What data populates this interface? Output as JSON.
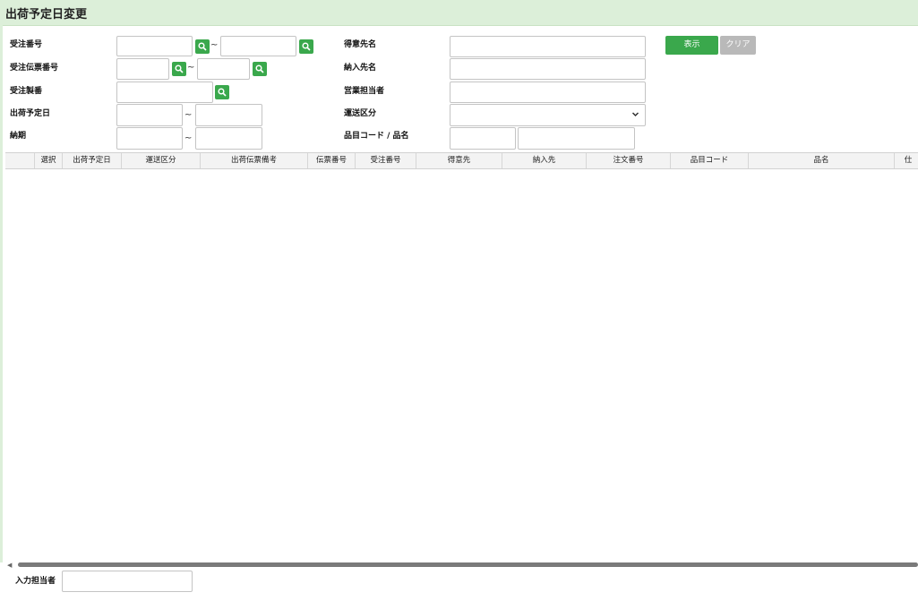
{
  "title": "出荷予定日変更",
  "form": {
    "order_no": "受注番号",
    "order_slip_no": "受注伝票番号",
    "order_mfg_no": "受注製番",
    "ship_date": "出荷予定日",
    "due_date": "納期",
    "customer_name": "得意先名",
    "delivery_name": "納入先名",
    "sales_rep": "営業担当者",
    "transport_class": "運送区分",
    "item_code_name": "品目コード / 品名",
    "tilde": "~",
    "transport_selected": ""
  },
  "buttons": {
    "show": "表示",
    "clear": "クリア"
  },
  "grid": {
    "columns": [
      "",
      "選択",
      "出荷予定日",
      "運送区分",
      "出荷伝票備考",
      "伝票番号",
      "受注番号",
      "得意先",
      "納入先",
      "注文番号",
      "品目コード",
      "品名",
      "仕"
    ]
  },
  "footer": {
    "input_person": "入力担当者"
  },
  "colors": {
    "accent": "#3aa84c",
    "title_bg": "#dcefd9",
    "clear_bg": "#b9b9b9"
  }
}
